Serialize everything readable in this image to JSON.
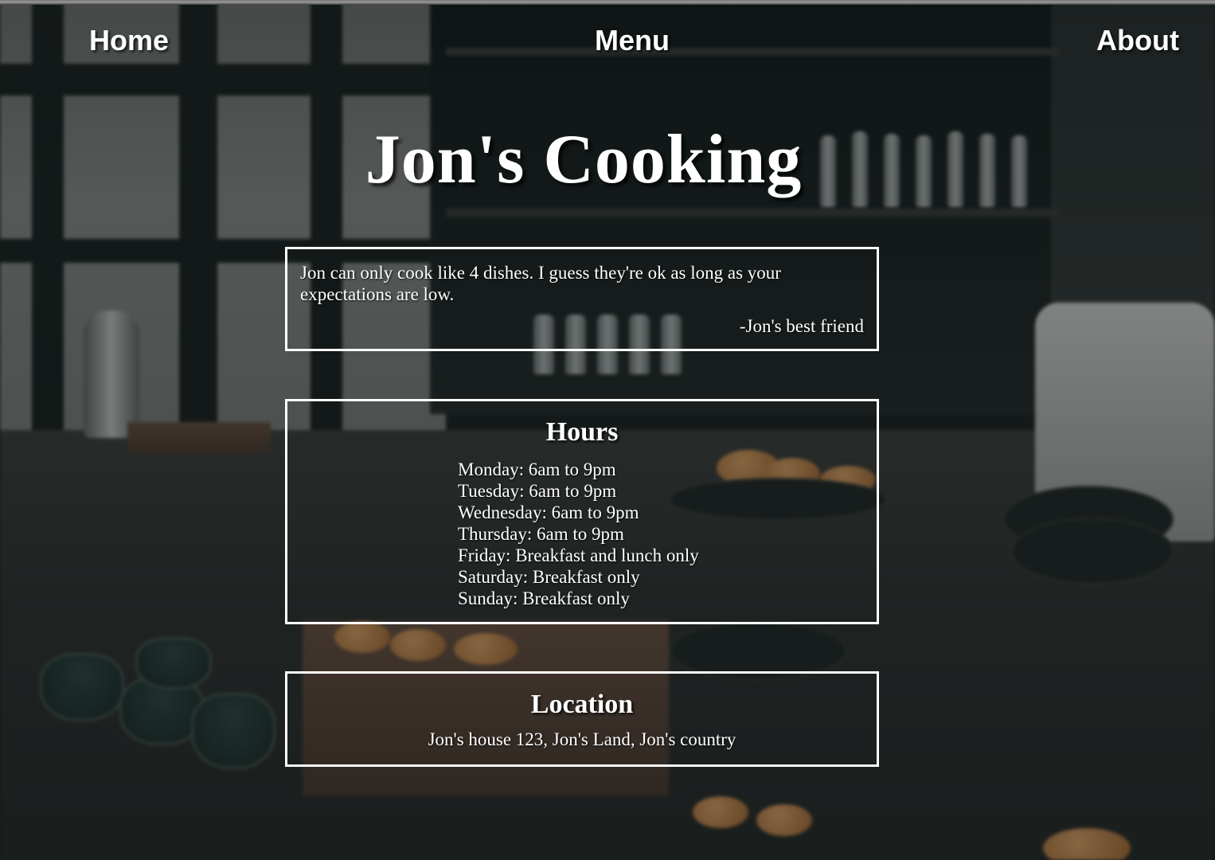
{
  "nav": {
    "home": "Home",
    "menu": "Menu",
    "about": "About"
  },
  "title": "Jon's Cooking",
  "quote": {
    "text": "Jon can only cook like 4 dishes. I guess they're ok as long as your expectations are low.",
    "author": "-Jon's best friend"
  },
  "hours": {
    "heading": "Hours",
    "items": [
      "Monday: 6am to 9pm",
      "Tuesday: 6am to 9pm",
      "Wednesday: 6am to 9pm",
      "Thursday: 6am to 9pm",
      "Friday: Breakfast and lunch only",
      "Saturday: Breakfast only",
      "Sunday: Breakfast only"
    ]
  },
  "location": {
    "heading": "Location",
    "address": "Jon's house 123, Jon's Land, Jon's country"
  },
  "colors": {
    "text": "#ffffff",
    "box_border": "#ffffff"
  }
}
